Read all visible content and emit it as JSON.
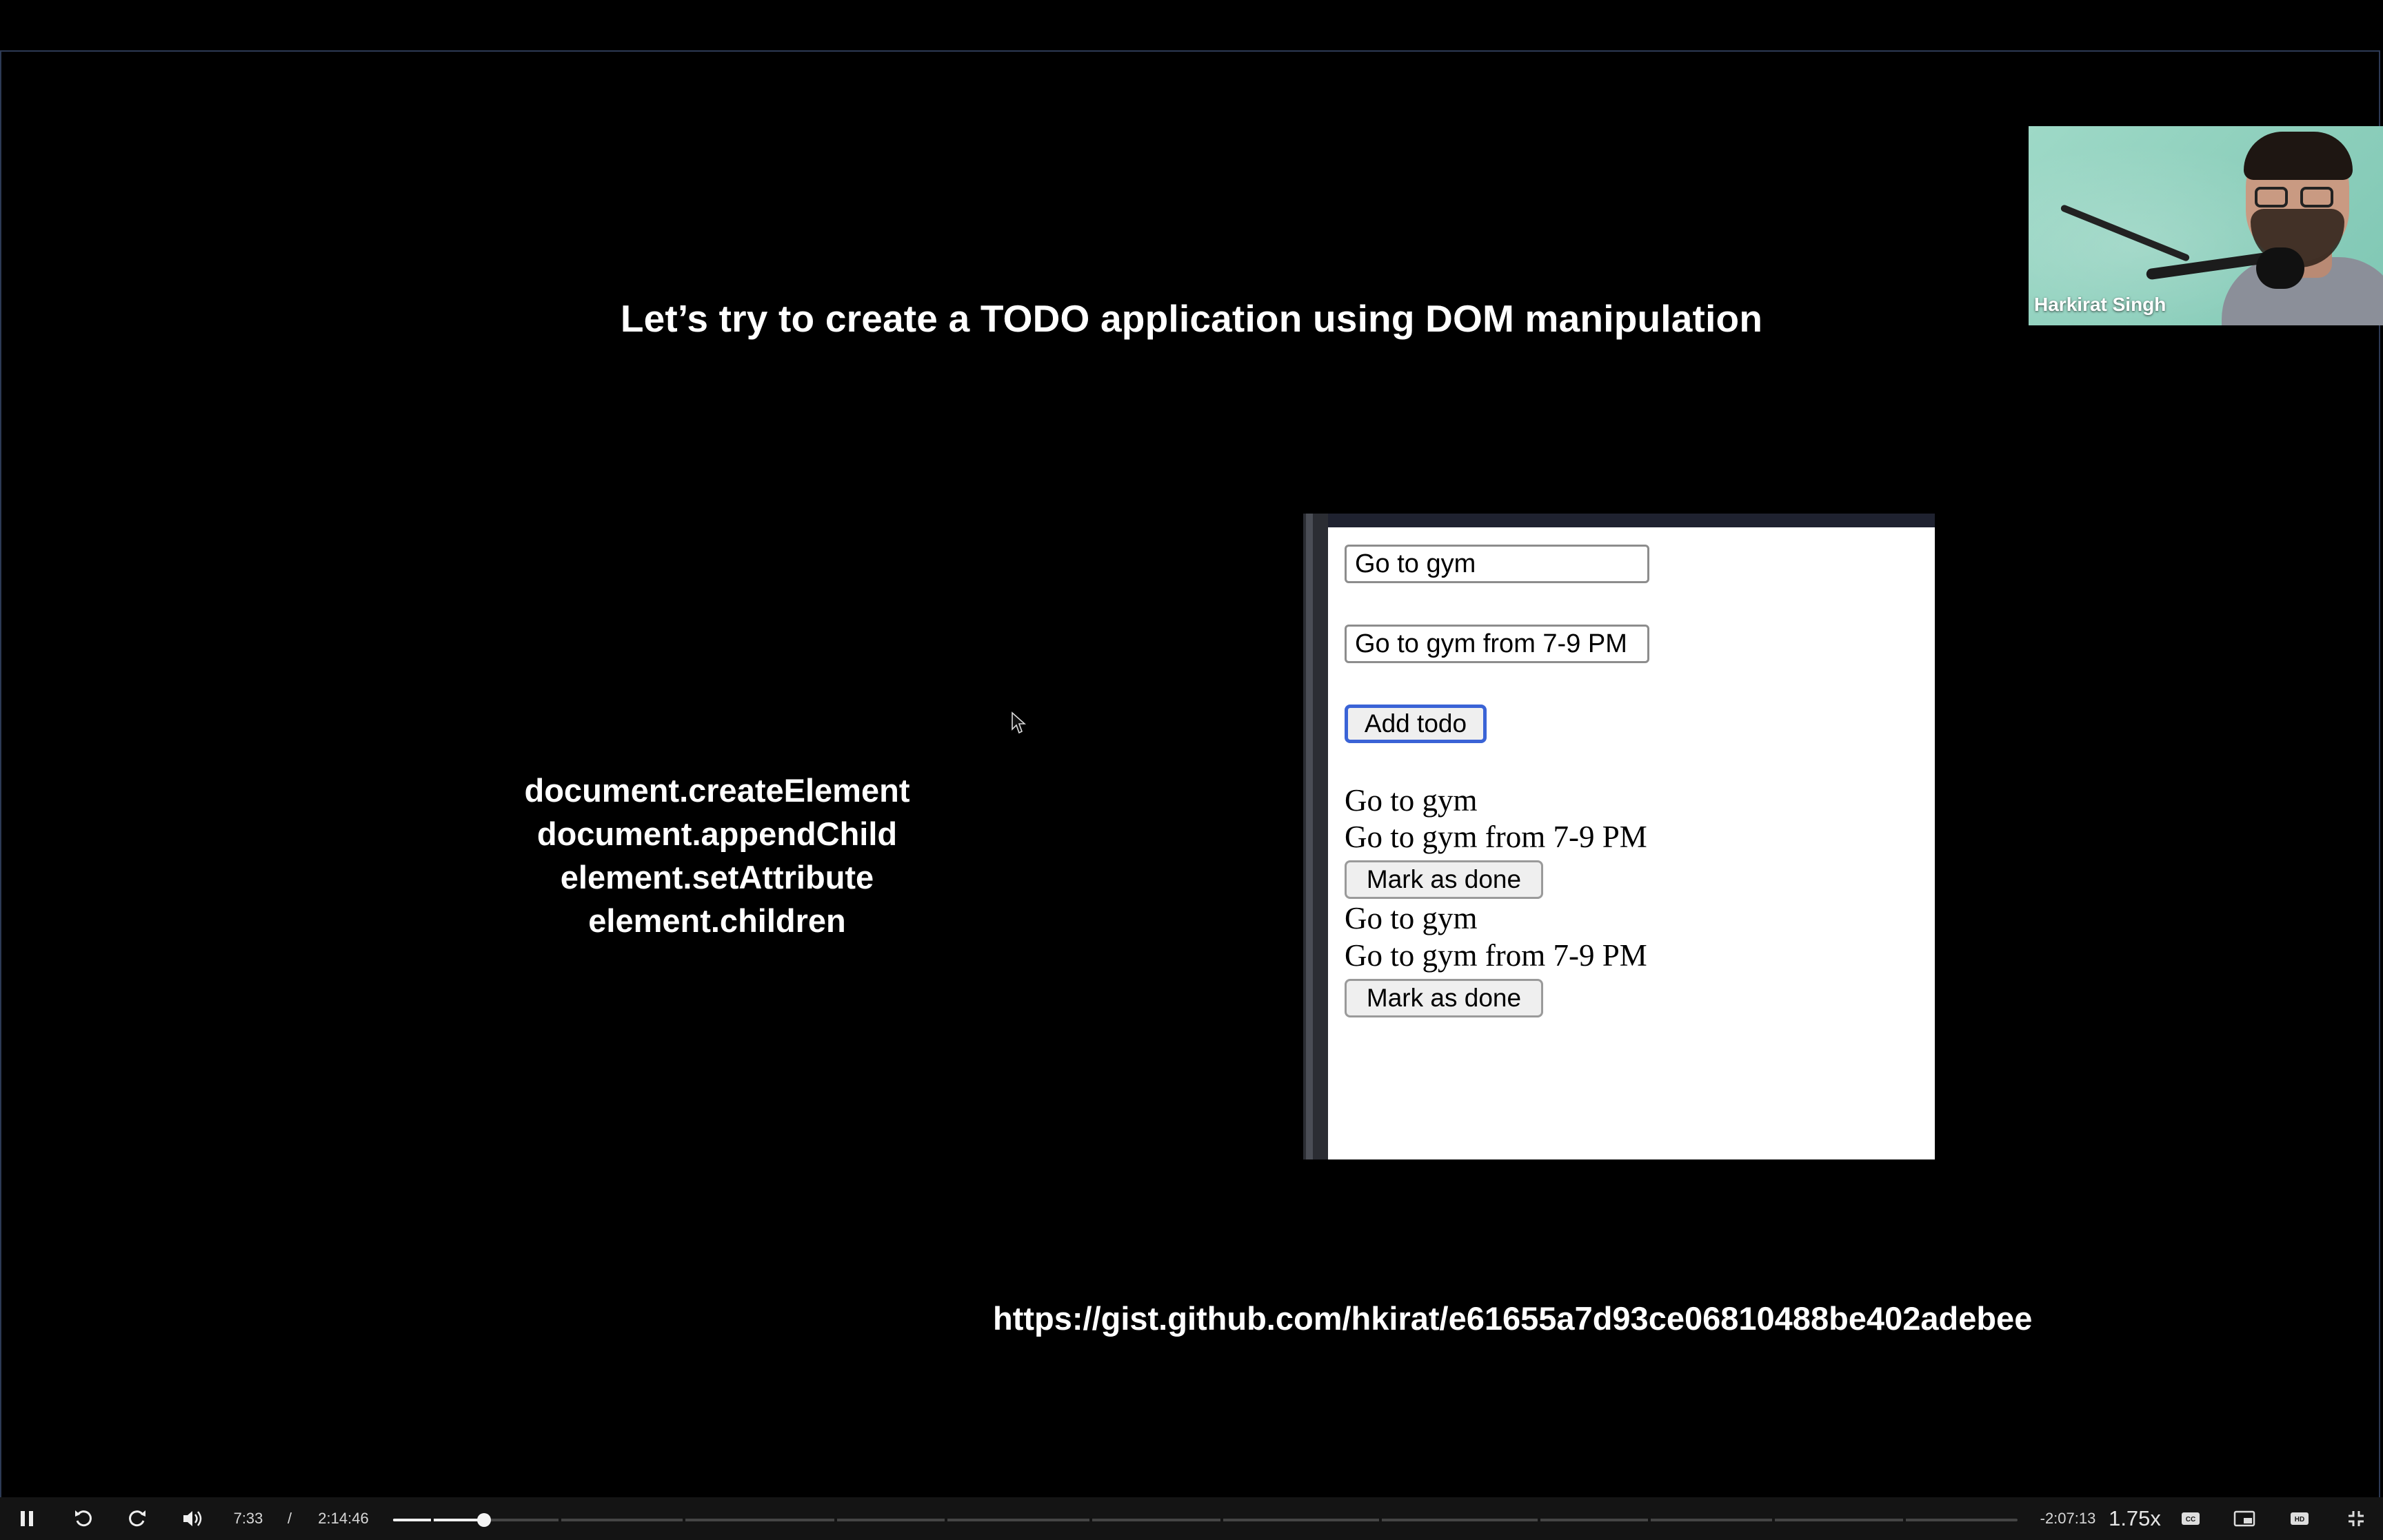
{
  "slide": {
    "title": "Let’s try to create a TODO application using DOM manipulation",
    "methods": [
      "document.createElement",
      "document.appendChild",
      "element.setAttribute",
      "element.children"
    ],
    "gist_url": "https://gist.github.com/hkirat/e61655a7d93ce06810488be402adebee"
  },
  "webcam": {
    "presenter_name": "Harkirat Singh"
  },
  "demo_app": {
    "title_input_value": "Go to gym",
    "description_input_value": "Go to gym from 7-9 PM",
    "add_button_label": "Add todo",
    "todos": [
      {
        "title": "Go to gym",
        "description": "Go to gym from 7-9 PM",
        "button_label": "Mark as done"
      },
      {
        "title": "Go to gym",
        "description": "Go to gym from 7-9 PM",
        "button_label": "Mark as done"
      }
    ]
  },
  "player": {
    "current_time": "7:33",
    "separator": "/",
    "total_time": "2:14:46",
    "remaining_time": "-2:07:13",
    "playback_rate": "1.75x",
    "progress_fraction": 0.056,
    "buffered_fraction": 0.028,
    "icons": {
      "pause": "pause-icon",
      "rewind": "rewind-icon",
      "forward": "forward-icon",
      "volume": "volume-icon",
      "captions": "captions-icon",
      "pip": "picture-in-picture-icon",
      "hd": "hd-icon",
      "fullscreen_exit": "exit-fullscreen-icon"
    }
  }
}
